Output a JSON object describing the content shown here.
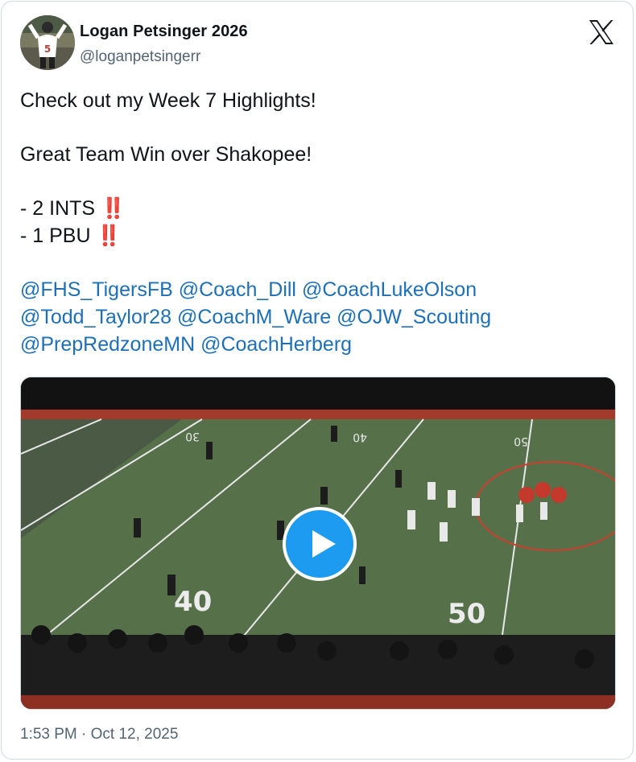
{
  "author": {
    "name": "Logan Petsinger 2026",
    "handle": "@loganpetsingerr",
    "avatar_icon": "player-avatar"
  },
  "brand_icon": "x-logo-icon",
  "tweet": {
    "line1": "Check out my Week 7 Highlights!",
    "line2": "Great Team Win over Shakopee!",
    "stat1": "- 2 INTS",
    "stat2": "- 1 PBU",
    "emphasis": "‼️",
    "mentions": [
      "@FHS_TigersFB",
      "@Coach_Dill",
      "@CoachLukeOlson",
      "@Todd_Taylor28",
      "@CoachM_Ware",
      "@OJW_Scouting",
      "@PrepRedzoneMN",
      "@CoachHerberg"
    ]
  },
  "media": {
    "type": "video",
    "field_markings": [
      "30",
      "40",
      "50",
      "40",
      "50"
    ],
    "control_icon": "play-icon"
  },
  "timestamp": "1:53 PM · Oct 12, 2025",
  "colors": {
    "mention": "#1d70b8",
    "play_button": "#1d9bf0",
    "emphasis": "#d8273a",
    "secondary_text": "#536471"
  }
}
